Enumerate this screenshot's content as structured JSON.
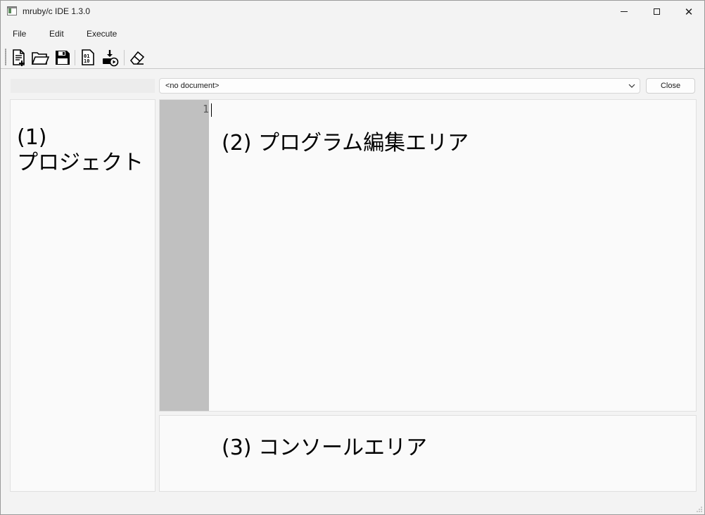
{
  "window": {
    "title": "mruby/c IDE 1.3.0"
  },
  "title_controls": {
    "minimize_glyph": "",
    "maximize_glyph": "",
    "close_glyph": "✕"
  },
  "menu": {
    "file": "File",
    "edit": "Edit",
    "execute": "Execute"
  },
  "toolbar": {
    "icons": [
      "new-file-icon",
      "open-folder-icon",
      "save-icon",
      "compile-icon",
      "download-run-icon",
      "eraser-icon"
    ]
  },
  "document_selector": {
    "value": "<no document>"
  },
  "buttons": {
    "close": "Close"
  },
  "project_panel": {
    "label": "(1)\nプロジェクト"
  },
  "editor": {
    "line_number": "1",
    "label": "(2) プログラム編集エリア"
  },
  "console": {
    "label": "(3) コンソールエリア"
  },
  "colors": {
    "background": "#f3f3f3",
    "panel": "#fafafa",
    "gutter": "#c0c0c0"
  }
}
